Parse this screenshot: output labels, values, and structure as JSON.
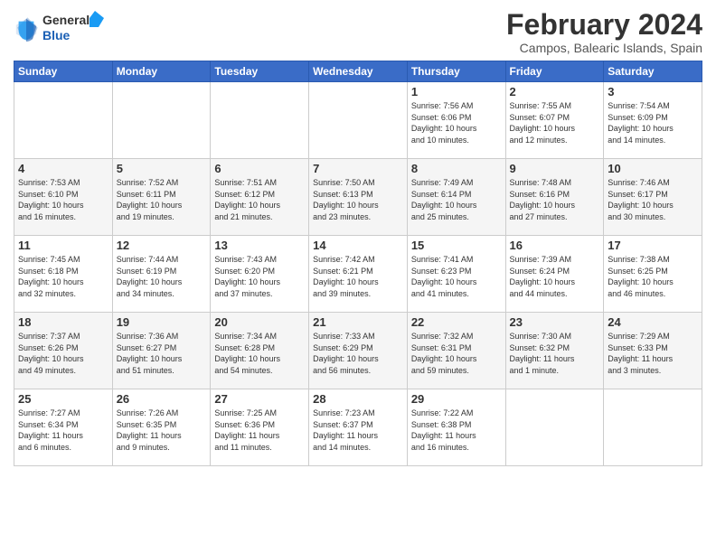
{
  "header": {
    "logo_line1": "General",
    "logo_line2": "Blue",
    "month_year": "February 2024",
    "location": "Campos, Balearic Islands, Spain"
  },
  "weekdays": [
    "Sunday",
    "Monday",
    "Tuesday",
    "Wednesday",
    "Thursday",
    "Friday",
    "Saturday"
  ],
  "weeks": [
    [
      {
        "day": "",
        "info": ""
      },
      {
        "day": "",
        "info": ""
      },
      {
        "day": "",
        "info": ""
      },
      {
        "day": "",
        "info": ""
      },
      {
        "day": "1",
        "info": "Sunrise: 7:56 AM\nSunset: 6:06 PM\nDaylight: 10 hours\nand 10 minutes."
      },
      {
        "day": "2",
        "info": "Sunrise: 7:55 AM\nSunset: 6:07 PM\nDaylight: 10 hours\nand 12 minutes."
      },
      {
        "day": "3",
        "info": "Sunrise: 7:54 AM\nSunset: 6:09 PM\nDaylight: 10 hours\nand 14 minutes."
      }
    ],
    [
      {
        "day": "4",
        "info": "Sunrise: 7:53 AM\nSunset: 6:10 PM\nDaylight: 10 hours\nand 16 minutes."
      },
      {
        "day": "5",
        "info": "Sunrise: 7:52 AM\nSunset: 6:11 PM\nDaylight: 10 hours\nand 19 minutes."
      },
      {
        "day": "6",
        "info": "Sunrise: 7:51 AM\nSunset: 6:12 PM\nDaylight: 10 hours\nand 21 minutes."
      },
      {
        "day": "7",
        "info": "Sunrise: 7:50 AM\nSunset: 6:13 PM\nDaylight: 10 hours\nand 23 minutes."
      },
      {
        "day": "8",
        "info": "Sunrise: 7:49 AM\nSunset: 6:14 PM\nDaylight: 10 hours\nand 25 minutes."
      },
      {
        "day": "9",
        "info": "Sunrise: 7:48 AM\nSunset: 6:16 PM\nDaylight: 10 hours\nand 27 minutes."
      },
      {
        "day": "10",
        "info": "Sunrise: 7:46 AM\nSunset: 6:17 PM\nDaylight: 10 hours\nand 30 minutes."
      }
    ],
    [
      {
        "day": "11",
        "info": "Sunrise: 7:45 AM\nSunset: 6:18 PM\nDaylight: 10 hours\nand 32 minutes."
      },
      {
        "day": "12",
        "info": "Sunrise: 7:44 AM\nSunset: 6:19 PM\nDaylight: 10 hours\nand 34 minutes."
      },
      {
        "day": "13",
        "info": "Sunrise: 7:43 AM\nSunset: 6:20 PM\nDaylight: 10 hours\nand 37 minutes."
      },
      {
        "day": "14",
        "info": "Sunrise: 7:42 AM\nSunset: 6:21 PM\nDaylight: 10 hours\nand 39 minutes."
      },
      {
        "day": "15",
        "info": "Sunrise: 7:41 AM\nSunset: 6:23 PM\nDaylight: 10 hours\nand 41 minutes."
      },
      {
        "day": "16",
        "info": "Sunrise: 7:39 AM\nSunset: 6:24 PM\nDaylight: 10 hours\nand 44 minutes."
      },
      {
        "day": "17",
        "info": "Sunrise: 7:38 AM\nSunset: 6:25 PM\nDaylight: 10 hours\nand 46 minutes."
      }
    ],
    [
      {
        "day": "18",
        "info": "Sunrise: 7:37 AM\nSunset: 6:26 PM\nDaylight: 10 hours\nand 49 minutes."
      },
      {
        "day": "19",
        "info": "Sunrise: 7:36 AM\nSunset: 6:27 PM\nDaylight: 10 hours\nand 51 minutes."
      },
      {
        "day": "20",
        "info": "Sunrise: 7:34 AM\nSunset: 6:28 PM\nDaylight: 10 hours\nand 54 minutes."
      },
      {
        "day": "21",
        "info": "Sunrise: 7:33 AM\nSunset: 6:29 PM\nDaylight: 10 hours\nand 56 minutes."
      },
      {
        "day": "22",
        "info": "Sunrise: 7:32 AM\nSunset: 6:31 PM\nDaylight: 10 hours\nand 59 minutes."
      },
      {
        "day": "23",
        "info": "Sunrise: 7:30 AM\nSunset: 6:32 PM\nDaylight: 11 hours\nand 1 minute."
      },
      {
        "day": "24",
        "info": "Sunrise: 7:29 AM\nSunset: 6:33 PM\nDaylight: 11 hours\nand 3 minutes."
      }
    ],
    [
      {
        "day": "25",
        "info": "Sunrise: 7:27 AM\nSunset: 6:34 PM\nDaylight: 11 hours\nand 6 minutes."
      },
      {
        "day": "26",
        "info": "Sunrise: 7:26 AM\nSunset: 6:35 PM\nDaylight: 11 hours\nand 9 minutes."
      },
      {
        "day": "27",
        "info": "Sunrise: 7:25 AM\nSunset: 6:36 PM\nDaylight: 11 hours\nand 11 minutes."
      },
      {
        "day": "28",
        "info": "Sunrise: 7:23 AM\nSunset: 6:37 PM\nDaylight: 11 hours\nand 14 minutes."
      },
      {
        "day": "29",
        "info": "Sunrise: 7:22 AM\nSunset: 6:38 PM\nDaylight: 11 hours\nand 16 minutes."
      },
      {
        "day": "",
        "info": ""
      },
      {
        "day": "",
        "info": ""
      }
    ]
  ]
}
